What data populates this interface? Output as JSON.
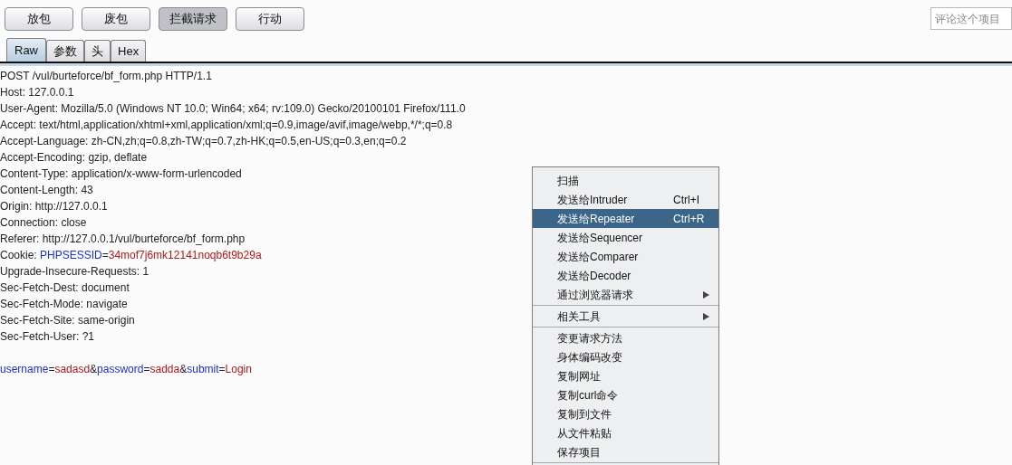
{
  "toolbar": {
    "buttons": [
      {
        "label": "放包",
        "on": false
      },
      {
        "label": "废包",
        "on": false
      },
      {
        "label": "拦截请求",
        "on": true
      },
      {
        "label": "行动",
        "on": false
      }
    ],
    "comment_field": {
      "placeholder": "评论这个项目"
    }
  },
  "tabs": [
    {
      "label": "Raw",
      "selected": true
    },
    {
      "label": "参数",
      "selected": false
    },
    {
      "label": "头",
      "selected": false
    },
    {
      "label": "Hex",
      "selected": false
    }
  ],
  "request_lines": [
    {
      "kind": "plain",
      "text": "POST /vul/burteforce/bf_form.php HTTP/1.1"
    },
    {
      "kind": "plain",
      "text": "Host: 127.0.0.1"
    },
    {
      "kind": "plain",
      "text": "User-Agent: Mozilla/5.0 (Windows NT 10.0; Win64; x64; rv:109.0) Gecko/20100101 Firefox/111.0"
    },
    {
      "kind": "plain",
      "text": "Accept: text/html,application/xhtml+xml,application/xml;q=0.9,image/avif,image/webp,*/*;q=0.8"
    },
    {
      "kind": "plain",
      "text": "Accept-Language: zh-CN,zh;q=0.8,zh-TW;q=0.7,zh-HK;q=0.5,en-US;q=0.3,en;q=0.2"
    },
    {
      "kind": "plain",
      "text": "Accept-Encoding: gzip, deflate"
    },
    {
      "kind": "plain",
      "text": "Content-Type: application/x-www-form-urlencoded"
    },
    {
      "kind": "plain",
      "text": "Content-Length: 43"
    },
    {
      "kind": "plain",
      "text": "Origin: http://127.0.0.1"
    },
    {
      "kind": "plain",
      "text": "Connection: close"
    },
    {
      "kind": "plain",
      "text": "Referer: http://127.0.0.1/vul/burteforce/bf_form.php"
    },
    {
      "kind": "parts",
      "parts": [
        {
          "kind": "plain",
          "text": "Cookie: "
        },
        {
          "kind": "name",
          "text": "PHPSESSID"
        },
        {
          "kind": "plain",
          "text": "="
        },
        {
          "kind": "value",
          "text": "34mof7j6mk12141noqb6t9b29a"
        }
      ]
    },
    {
      "kind": "plain",
      "text": "Upgrade-Insecure-Requests: 1"
    },
    {
      "kind": "plain",
      "text": "Sec-Fetch-Dest: document"
    },
    {
      "kind": "plain",
      "text": "Sec-Fetch-Mode: navigate"
    },
    {
      "kind": "plain",
      "text": "Sec-Fetch-Site: same-origin"
    },
    {
      "kind": "plain",
      "text": "Sec-Fetch-User: ?1"
    },
    {
      "kind": "blank"
    },
    {
      "kind": "parts",
      "parts": [
        {
          "kind": "name",
          "text": "username"
        },
        {
          "kind": "plain",
          "text": "="
        },
        {
          "kind": "value",
          "text": "sadasd"
        },
        {
          "kind": "plain",
          "text": "&"
        },
        {
          "kind": "name",
          "text": "password"
        },
        {
          "kind": "plain",
          "text": "="
        },
        {
          "kind": "value",
          "text": "sadda"
        },
        {
          "kind": "plain",
          "text": "&"
        },
        {
          "kind": "name",
          "text": "submit"
        },
        {
          "kind": "plain",
          "text": "="
        },
        {
          "kind": "value",
          "text": "Login"
        }
      ]
    }
  ],
  "context_menu": {
    "groups": [
      [
        {
          "label": "扫描",
          "selected": false
        },
        {
          "label": "发送给Intruder",
          "shortcut": "Ctrl+I",
          "selected": false
        },
        {
          "label": "发送给Repeater",
          "shortcut": "Ctrl+R",
          "selected": true
        },
        {
          "label": "发送给Sequencer",
          "selected": false
        },
        {
          "label": "发送给Comparer",
          "selected": false
        },
        {
          "label": "发送给Decoder",
          "selected": false
        },
        {
          "label": "通过浏览器请求",
          "submenu": true,
          "selected": false
        }
      ],
      [
        {
          "label": "相关工具",
          "submenu": true,
          "selected": false
        }
      ],
      [
        {
          "label": "变更请求方法",
          "selected": false
        },
        {
          "label": "身体编码改变",
          "selected": false
        },
        {
          "label": "复制网址",
          "selected": false
        },
        {
          "label": "复制curl命令",
          "selected": false
        },
        {
          "label": "复制到文件",
          "selected": false
        },
        {
          "label": "从文件粘贴",
          "selected": false
        },
        {
          "label": "保存项目",
          "selected": false
        }
      ]
    ]
  }
}
